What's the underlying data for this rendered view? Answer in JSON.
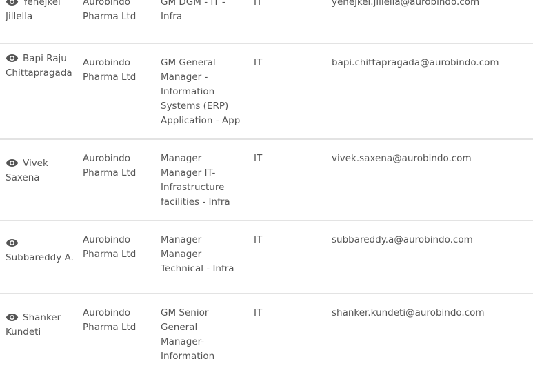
{
  "contacts": [
    {
      "name": "Yehejkel Jillella",
      "company": "Aurobindo Pharma Ltd",
      "title": "GM DGM - IT - Infra",
      "department": "IT",
      "email": "yehejkel.jillella@aurobindo.com"
    },
    {
      "name": "Bapi Raju Chittapragada",
      "company": "Aurobindo Pharma Ltd",
      "title": "GM General Manager - Information Systems (ERP) Application - App",
      "department": "IT",
      "email": "bapi.chittapragada@aurobindo.com"
    },
    {
      "name": "Vivek Saxena",
      "company": "Aurobindo Pharma Ltd",
      "title": "Manager Manager IT-Infrastructure facilities - Infra",
      "department": "IT",
      "email": "vivek.saxena@aurobindo.com"
    },
    {
      "name": "Subbareddy A.",
      "company": "Aurobindo Pharma Ltd",
      "title": "Manager Manager Technical - Infra",
      "department": "IT",
      "email": "subbareddy.a@aurobindo.com"
    },
    {
      "name": "Shanker Kundeti",
      "company": "Aurobindo Pharma Ltd",
      "title": "GM Senior General Manager-Information",
      "department": "IT",
      "email": "shanker.kundeti@aurobindo.com"
    }
  ],
  "icons": {
    "view": "eye-icon"
  }
}
